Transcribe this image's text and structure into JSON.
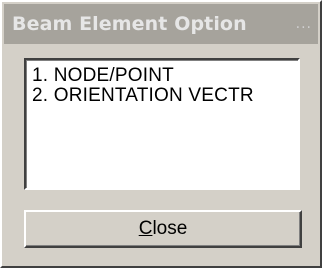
{
  "window": {
    "title": "Beam Element Option",
    "title_extra": "..."
  },
  "list": {
    "items": [
      "1. NODE/POINT",
      "2. ORIENTATION VECTR"
    ]
  },
  "buttons": {
    "close_mnemonic": "C",
    "close_rest": "lose"
  },
  "colors": {
    "dialog_face": "#d4d0c8",
    "inactive_titlebar": "#a6a39c",
    "title_text": "#e6e6e6",
    "list_background": "#ffffff"
  }
}
